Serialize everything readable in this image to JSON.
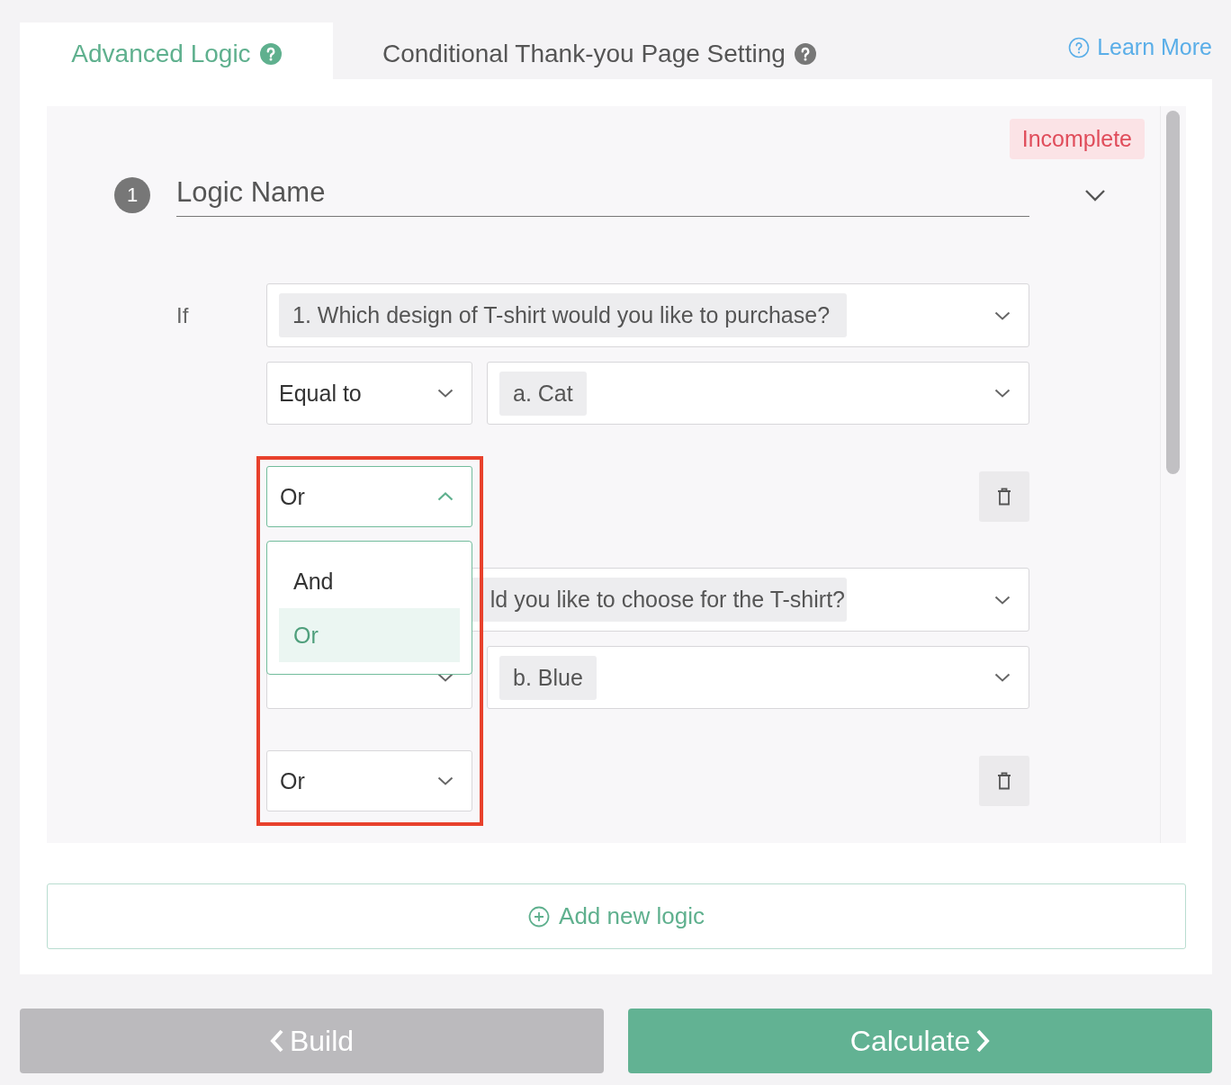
{
  "tabs": [
    {
      "label": "Advanced Logic",
      "selected": true
    },
    {
      "label": "Conditional Thank-you Page Setting",
      "selected": false
    }
  ],
  "learn_more": "Learn More",
  "logic": {
    "number": "1",
    "status": "Incomplete",
    "name_placeholder": "Logic Name",
    "if_label": "If",
    "conditions": [
      {
        "question": "1. Which design of T-shirt would you like to purchase?",
        "operator": "Equal to",
        "answer": "a. Cat",
        "connector": "Or",
        "connector_expanded": true
      },
      {
        "question": "ld you like to choose for the T-shirt?",
        "answer": "b. Blue",
        "connector": "Or",
        "connector_expanded": false
      }
    ],
    "connector_menu": [
      {
        "label": "And",
        "selected": false
      },
      {
        "label": "Or",
        "selected": true
      }
    ]
  },
  "add_logic": "Add new logic",
  "buttons": [
    {
      "label": "Build",
      "kind": "back"
    },
    {
      "label": "Calculate",
      "kind": "next"
    }
  ]
}
